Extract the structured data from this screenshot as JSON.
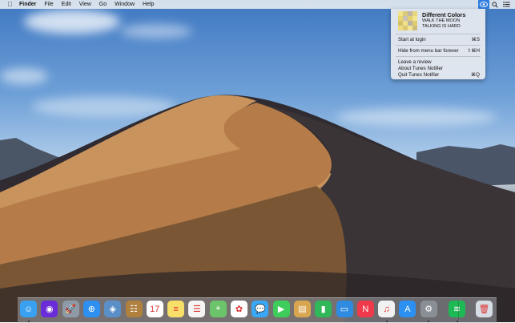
{
  "menubar": {
    "app_menu": "Finder",
    "items": [
      "File",
      "Edit",
      "View",
      "Go",
      "Window",
      "Help"
    ]
  },
  "notifier": {
    "track": {
      "title": "Different Colors",
      "artist": "WALK THE MOON",
      "album": "TALKING IS HARD"
    },
    "menu": [
      {
        "label": "Start at login",
        "shortcut": "⌘S"
      },
      {
        "label": "Hide from menu bar forever",
        "shortcut": "⇧⌘H"
      },
      {
        "label": "Leave a review",
        "shortcut": ""
      },
      {
        "label": "About Tunes Notifier",
        "shortcut": ""
      },
      {
        "label": "Quit Tunes Notifier",
        "shortcut": "⌘Q"
      }
    ]
  },
  "dock": {
    "items": [
      {
        "name": "finder-icon",
        "glyph": "☺",
        "color": "#3aa0f0",
        "running": true
      },
      {
        "name": "siri-icon",
        "glyph": "◉",
        "color": "#6a2bd8",
        "running": false
      },
      {
        "name": "launchpad-icon",
        "glyph": "🚀",
        "color": "#8e9aa8",
        "running": false
      },
      {
        "name": "safari-icon",
        "glyph": "⊕",
        "color": "#2d8ff0",
        "running": false
      },
      {
        "name": "photo-browser-icon",
        "glyph": "◈",
        "color": "#5a8fc8",
        "running": false
      },
      {
        "name": "contacts-icon",
        "glyph": "☷",
        "color": "#b0803e",
        "running": false
      },
      {
        "name": "calendar-icon",
        "glyph": "17",
        "color": "#ffffff",
        "running": false
      },
      {
        "name": "notes-icon",
        "glyph": "≡",
        "color": "#f7df6a",
        "running": false
      },
      {
        "name": "reminders-icon",
        "glyph": "☰",
        "color": "#f5f5f5",
        "running": false
      },
      {
        "name": "maps-icon",
        "glyph": "⌖",
        "color": "#6cc46a",
        "running": false
      },
      {
        "name": "photos-icon",
        "glyph": "✿",
        "color": "#ffffff",
        "running": false
      },
      {
        "name": "messages-icon",
        "glyph": "💬",
        "color": "#3aa8f5",
        "running": false
      },
      {
        "name": "facetime-icon",
        "glyph": "▶",
        "color": "#3ecc5a",
        "running": false
      },
      {
        "name": "preview-icon",
        "glyph": "▤",
        "color": "#d8a64e",
        "running": false
      },
      {
        "name": "numbers-icon",
        "glyph": "▮",
        "color": "#2fb75a",
        "running": false
      },
      {
        "name": "keynote-icon",
        "glyph": "▭",
        "color": "#2f8be0",
        "running": false
      },
      {
        "name": "news-icon",
        "glyph": "N",
        "color": "#f03a4c",
        "running": false
      },
      {
        "name": "itunes-icon",
        "glyph": "♫",
        "color": "#f2f2f2",
        "running": true
      },
      {
        "name": "app-store-icon",
        "glyph": "A",
        "color": "#2c8ff2",
        "running": false
      },
      {
        "name": "system-preferences-icon",
        "glyph": "⚙",
        "color": "#8a8f96",
        "running": true
      },
      {
        "name": "spotify-icon",
        "glyph": "≋",
        "color": "#1db954",
        "running": true
      },
      {
        "name": "trash-icon",
        "glyph": "🗑",
        "color": "#d7dde4",
        "running": false
      }
    ]
  }
}
